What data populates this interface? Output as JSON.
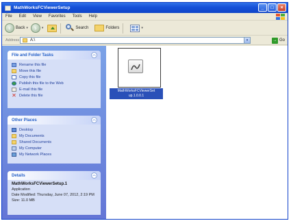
{
  "window": {
    "title": "MathWorksFCViewerSetup",
    "buttons": {
      "minimize": "_",
      "maximize": "□",
      "close": "×"
    }
  },
  "menu": [
    "File",
    "Edit",
    "View",
    "Favorites",
    "Tools",
    "Help"
  ],
  "toolbar": {
    "back": "Back",
    "search": "Search",
    "folders": "Folders"
  },
  "address": {
    "label": "Address",
    "value": "A:\\",
    "go": "Go"
  },
  "panels": {
    "tasks": {
      "title": "File and Folder Tasks",
      "items": [
        {
          "label": "Rename this file",
          "icon": "rename-icon"
        },
        {
          "label": "Move this file",
          "icon": "move-icon"
        },
        {
          "label": "Copy this file",
          "icon": "copy-icon"
        },
        {
          "label": "Publish this file to the Web",
          "icon": "globe-icon"
        },
        {
          "label": "E-mail this file",
          "icon": "email-icon"
        },
        {
          "label": "Delete this file",
          "icon": "delete-icon"
        }
      ]
    },
    "places": {
      "title": "Other Places",
      "items": [
        {
          "label": "Desktop",
          "icon": "desktop-icon"
        },
        {
          "label": "My Documents",
          "icon": "documents-icon"
        },
        {
          "label": "Shared Documents",
          "icon": "shared-folder-icon"
        },
        {
          "label": "My Computer",
          "icon": "computer-icon"
        },
        {
          "label": "My Network Places",
          "icon": "network-icon"
        }
      ]
    },
    "details": {
      "title": "Details",
      "name": "MathWorksFCViewerSetup.1",
      "type": "Application",
      "modified": "Date Modified: Thursday, June 07, 2012, 2:19 PM",
      "size": "Size: 11.0 MB"
    }
  },
  "file": {
    "icon_text": "",
    "name_line1": "MathWorksFCViewerSet",
    "name_line2": "up.1.0.0.1"
  },
  "colors": {
    "titlebar": "#1550d8",
    "taskpane": "#6f8ee0",
    "panel": "#d6dff7",
    "selection": "#2a50b8",
    "link": "#1f3e9a"
  }
}
